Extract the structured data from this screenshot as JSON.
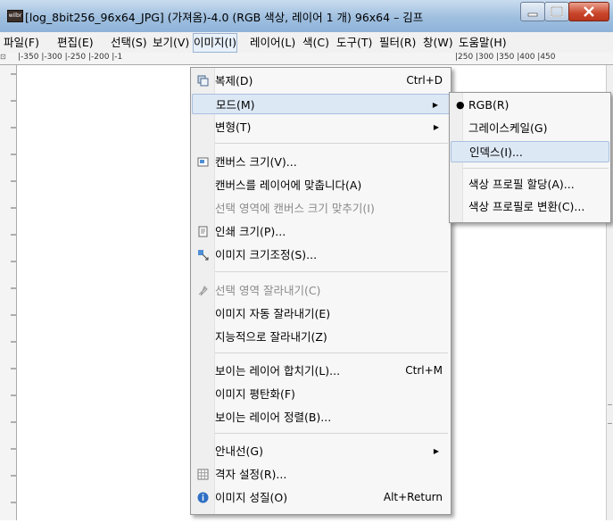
{
  "window": {
    "title": "[log_8bit256_96x64_JPG] (가져옴)-4.0 (RGB 색상, 레이어 1 개) 96x64 – 김프",
    "app_icon_text": "wilbr"
  },
  "menubar": {
    "items": [
      {
        "label": "파일(F)"
      },
      {
        "label": "편집(E)"
      },
      {
        "label": "선택(S)"
      },
      {
        "label": "보기(V)"
      },
      {
        "label": "이미지(I)"
      },
      {
        "label": "레이어(L)"
      },
      {
        "label": "색(C)"
      },
      {
        "label": "도구(T)"
      },
      {
        "label": "필터(R)"
      },
      {
        "label": "창(W)"
      },
      {
        "label": "도움말(H)"
      }
    ]
  },
  "ruler": {
    "left_ticks": "|-350 |-300 |-250 |-200 |-1",
    "right_ticks": "|250 |300 |350 |400 |450"
  },
  "image_menu": {
    "items": [
      {
        "label": "복제(D)",
        "shortcut": "Ctrl+D",
        "icon": "duplicate-icon"
      },
      {
        "label": "모드(M)",
        "submenu": true,
        "highlighted": true
      },
      {
        "label": "변형(T)",
        "submenu": true
      },
      {
        "label": "캔버스 크기(V)...",
        "icon": "canvas-size-icon"
      },
      {
        "label": "캔버스를 레이어에 맞춥니다(A)"
      },
      {
        "label": "선택 영역에 캔버스 크기 맞추기(I)",
        "disabled": true
      },
      {
        "label": "인쇄 크기(P)...",
        "icon": "print-size-icon"
      },
      {
        "label": "이미지 크기조정(S)...",
        "icon": "scale-image-icon"
      },
      {
        "label": "선택 영역 잘라내기(C)",
        "disabled": true,
        "icon": "crop-icon"
      },
      {
        "label": "이미지 자동 잘라내기(E)"
      },
      {
        "label": "지능적으로 잘라내기(Z)"
      },
      {
        "label": "보이는 레이어 합치기(L)...",
        "shortcut": "Ctrl+M"
      },
      {
        "label": "이미지 평탄화(F)"
      },
      {
        "label": "보이는 레이어 정렬(B)..."
      },
      {
        "label": "안내선(G)",
        "submenu": true
      },
      {
        "label": "격자 설정(R)...",
        "icon": "grid-icon"
      },
      {
        "label": "이미지 성질(O)",
        "shortcut": "Alt+Return",
        "icon": "info-icon"
      }
    ]
  },
  "mode_submenu": {
    "items": [
      {
        "label": "RGB(R)",
        "selected": true
      },
      {
        "label": "그레이스케일(G)"
      },
      {
        "label": "인덱스(I)...",
        "highlighted": true
      },
      {
        "label": "색상 프로필 할당(A)..."
      },
      {
        "label": "색상 프로필로 변환(C)..."
      }
    ]
  },
  "colors": {
    "titlebar": "#9fbfdf",
    "close_button": "#c9452a",
    "highlight": "#dde8f5"
  }
}
